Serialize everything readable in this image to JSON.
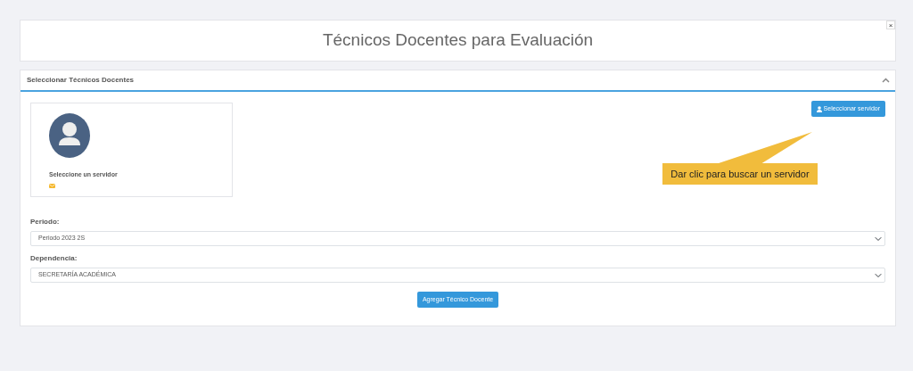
{
  "header": {
    "title": "Técnicos Docentes para Evaluación",
    "close": "×"
  },
  "panel": {
    "title": "Seleccionar Técnicos Docentes",
    "expanded": true,
    "profile": {
      "name": "Seleccione un servidor"
    },
    "select_button": "Seleccionar servidor",
    "callout": "Dar clic para buscar un servidor",
    "fields": [
      {
        "label": "Periodo:",
        "value": "Periodo 2023 2S"
      },
      {
        "label": "Dependencia:",
        "value": "SECRETARÍA ACADÉMICA"
      }
    ],
    "submit": "Agregar Técnico Docente"
  }
}
